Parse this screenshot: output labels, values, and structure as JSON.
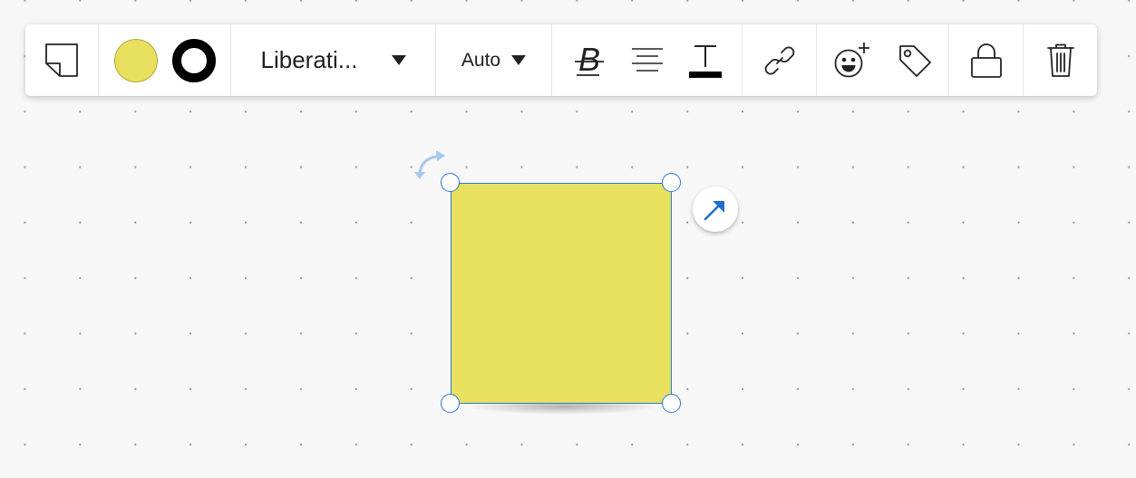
{
  "toolbar": {
    "shape_icon": "sticky-note-icon",
    "fill_color": "#e8e05f",
    "border_color": "#000000",
    "font_family": "Liberati...",
    "font_size": "Auto",
    "buttons": {
      "bold": "bold-strikethrough-icon",
      "align": "text-align-center-icon",
      "text_color": "text-color-icon",
      "link": "link-icon",
      "reaction": "add-reaction-icon",
      "tag": "tag-icon",
      "lock": "lock-icon",
      "delete": "trash-icon"
    }
  },
  "canvas": {
    "selection_color": "#2979d6",
    "sticky_note": {
      "fill": "#e8e05f",
      "text": ""
    },
    "icons": {
      "rotate": "rotate-icon",
      "connector": "arrow-up-right-icon"
    }
  }
}
